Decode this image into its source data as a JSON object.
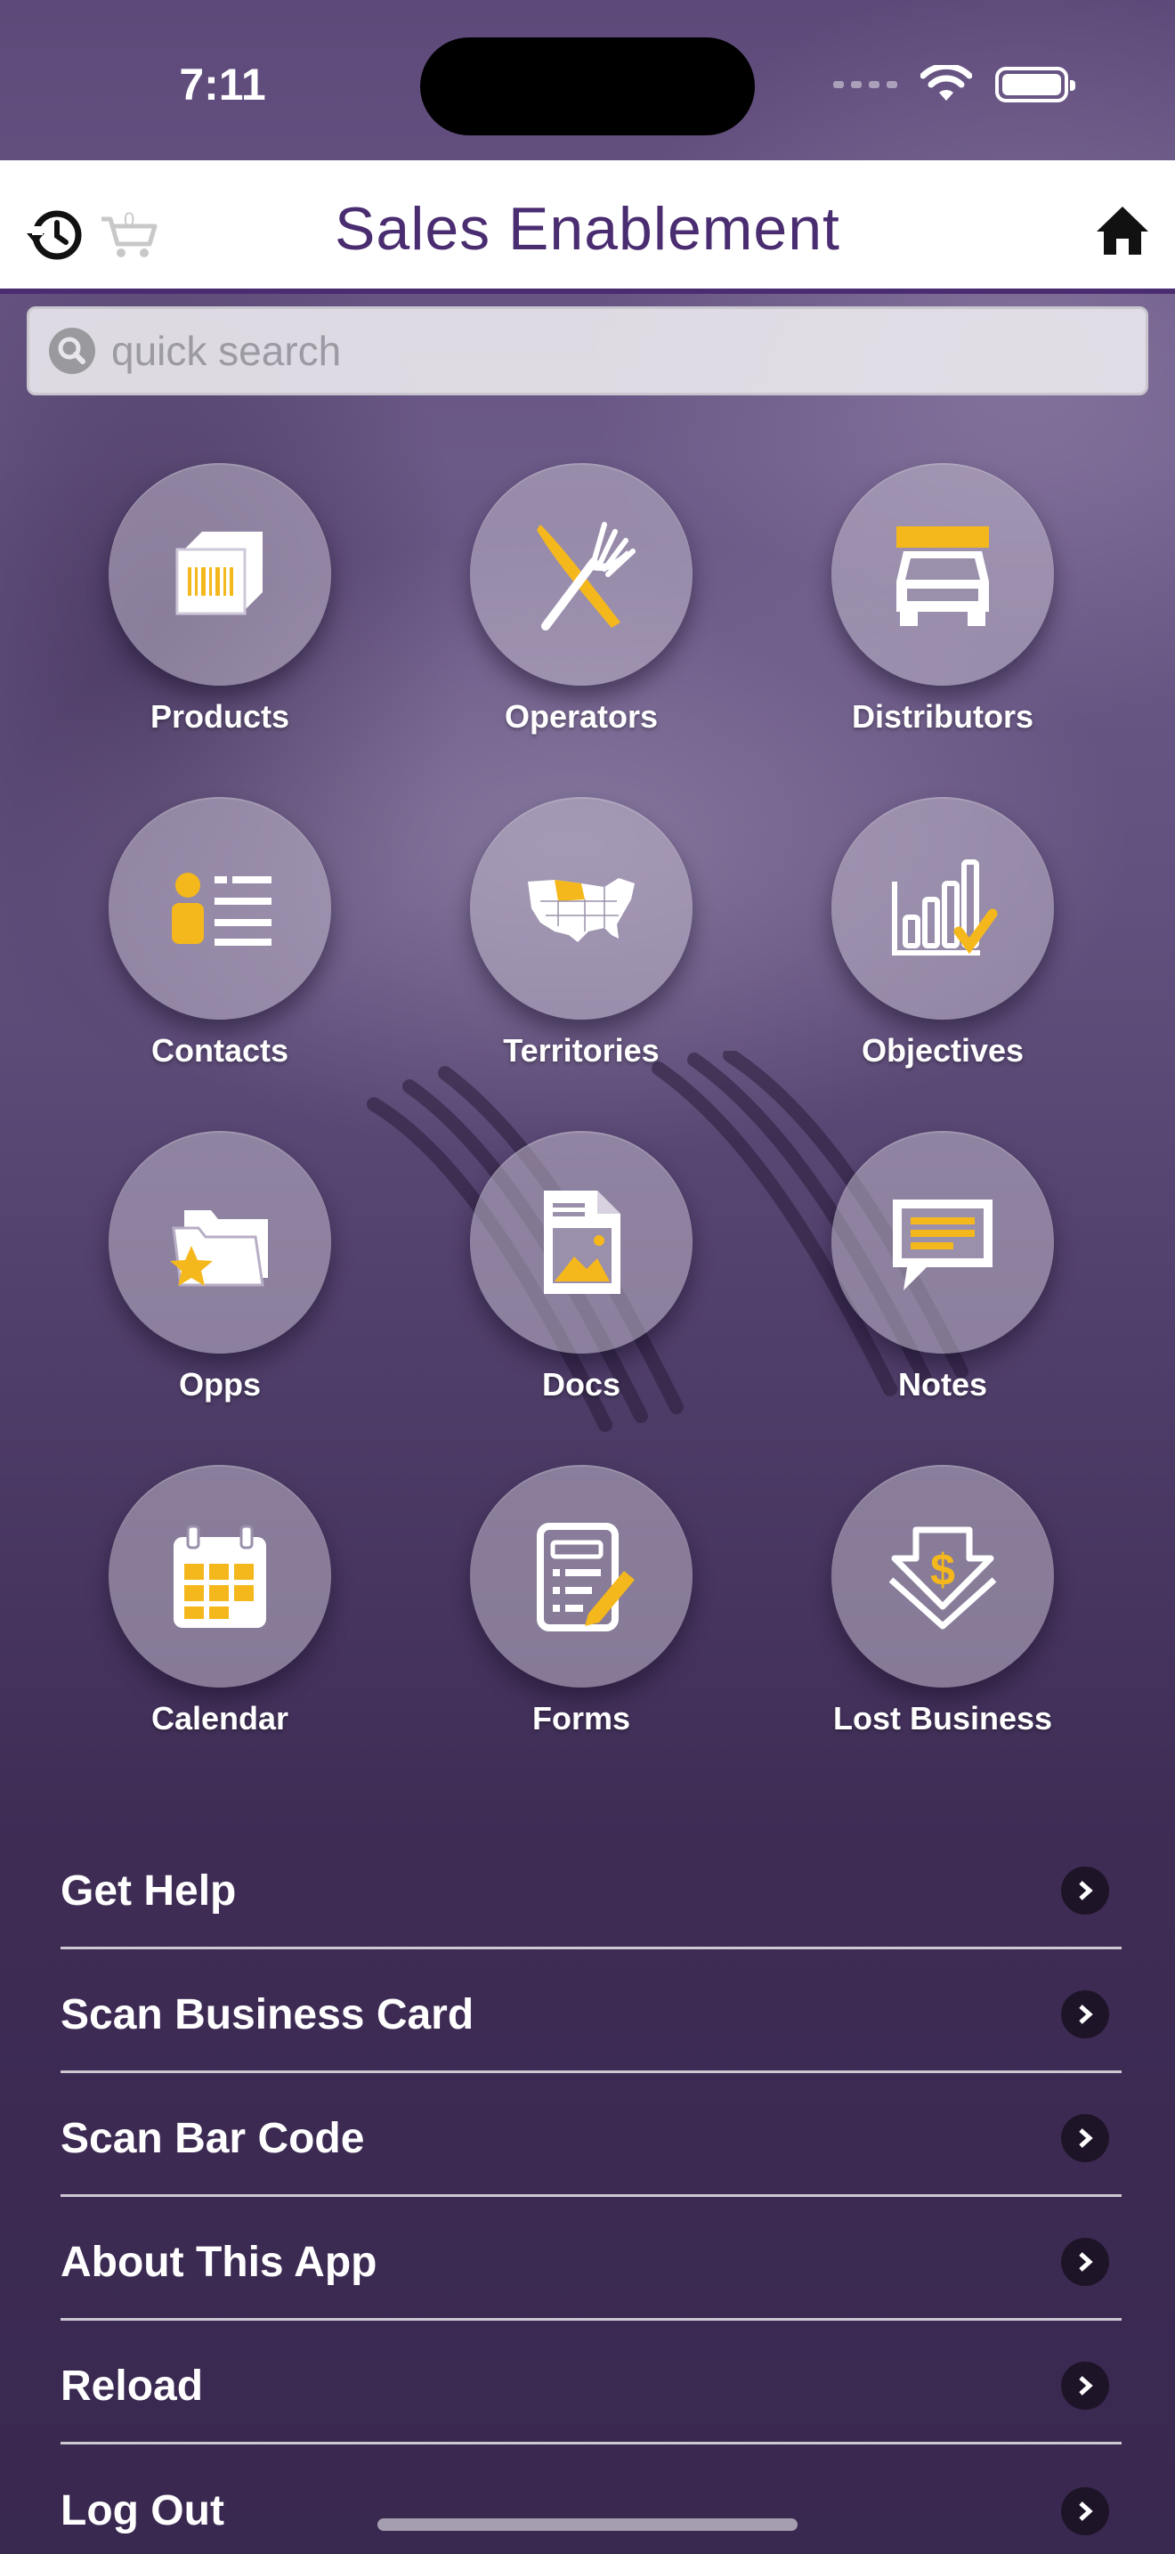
{
  "status_bar": {
    "time": "7:11"
  },
  "header": {
    "title": "Sales Enablement",
    "cart_count": "0"
  },
  "search": {
    "placeholder": "quick search",
    "value": ""
  },
  "tiles": [
    {
      "label": "Products",
      "icon": "barcode-box-icon"
    },
    {
      "label": "Operators",
      "icon": "knife-fork-icon"
    },
    {
      "label": "Distributors",
      "icon": "truck-icon"
    },
    {
      "label": "Contacts",
      "icon": "contact-card-icon"
    },
    {
      "label": "Territories",
      "icon": "us-map-icon"
    },
    {
      "label": "Objectives",
      "icon": "bar-chart-check-icon"
    },
    {
      "label": "Opps",
      "icon": "folder-star-icon"
    },
    {
      "label": "Docs",
      "icon": "document-image-icon"
    },
    {
      "label": "Notes",
      "icon": "speech-bubble-icon"
    },
    {
      "label": "Calendar",
      "icon": "calendar-icon"
    },
    {
      "label": "Forms",
      "icon": "form-pencil-icon"
    },
    {
      "label": "Lost Business",
      "icon": "dollar-down-arrow-icon"
    }
  ],
  "menu": [
    {
      "label": "Get Help"
    },
    {
      "label": "Scan Business Card"
    },
    {
      "label": "Scan Bar Code"
    },
    {
      "label": "About This App"
    },
    {
      "label": "Reload"
    },
    {
      "label": "Log Out"
    }
  ],
  "colors": {
    "accent": "#F5B81C",
    "brand_purple": "#4A2C70",
    "icon_white": "#FFFFFF"
  }
}
